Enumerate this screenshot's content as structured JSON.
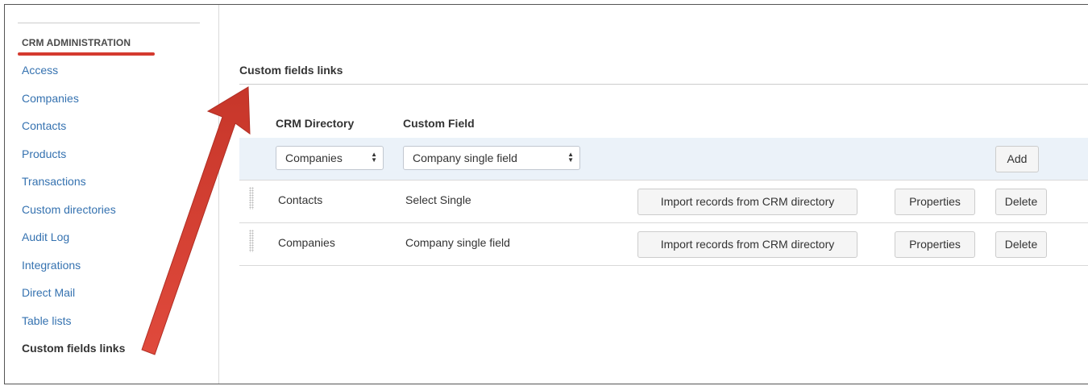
{
  "sidebar": {
    "heading": "CRM ADMINISTRATION",
    "items": [
      {
        "label": "Access"
      },
      {
        "label": "Companies"
      },
      {
        "label": "Contacts"
      },
      {
        "label": "Products"
      },
      {
        "label": "Transactions"
      },
      {
        "label": "Custom directories"
      },
      {
        "label": "Audit Log"
      },
      {
        "label": "Integrations"
      },
      {
        "label": "Direct Mail"
      },
      {
        "label": "Table lists"
      },
      {
        "label": "Custom fields links",
        "active": true
      }
    ]
  },
  "main": {
    "title": "Custom fields links",
    "columns": {
      "directory": "CRM Directory",
      "field": "Custom Field"
    },
    "add_row": {
      "directory_select": "Companies",
      "field_select": "Company single field",
      "add_label": "Add"
    },
    "rows": [
      {
        "directory": "Contacts",
        "field": "Select Single",
        "import_label": "Import records from CRM directory",
        "properties_label": "Properties",
        "delete_label": "Delete"
      },
      {
        "directory": "Companies",
        "field": "Company single field",
        "import_label": "Import records from CRM directory",
        "properties_label": "Properties",
        "delete_label": "Delete"
      }
    ]
  },
  "icons": {
    "select_arrows": "sort-arrows-icon",
    "drag_handle": "drag-handle-icon",
    "annotation": "red-arrow-annotation"
  },
  "colors": {
    "link": "#3572b0",
    "annotation_red": "#d43a2f",
    "add_row_bg": "#ebf2f9"
  }
}
